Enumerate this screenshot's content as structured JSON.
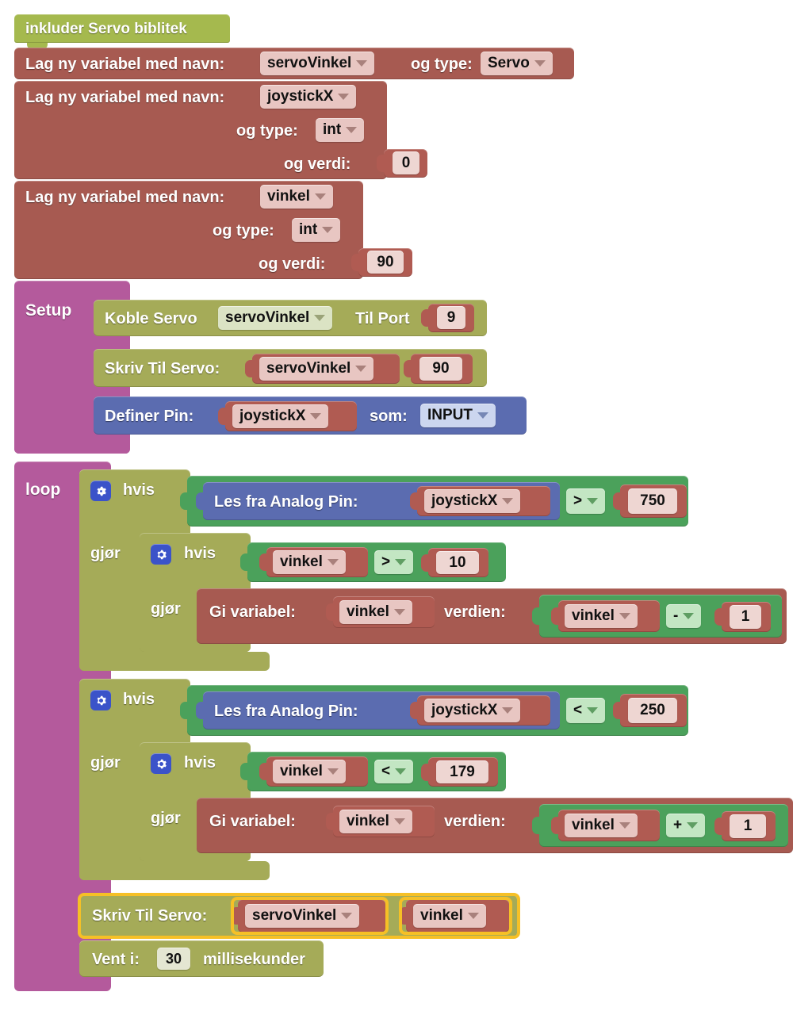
{
  "app": {
    "title": "Blockly Arduino workspace"
  },
  "palette": {
    "include_green": "#a5b94e",
    "variable_brown": "#a75a51",
    "setup_loop_purple": "#b45a9c",
    "olive": "#a5ab58",
    "logic_green": "#4ba15b",
    "io_blue": "#5b6cb0",
    "highlight_yellow": "#f6c026",
    "field_pink": "#e8c6c2",
    "field_green": "#c3e6c3"
  },
  "blocks": {
    "include": {
      "label": "inkluder Servo biblitek"
    },
    "declare_servo": {
      "label_name": "Lag ny variabel med navn:",
      "name_value": "servoVinkel",
      "label_type": "og type:",
      "type_value": "Servo"
    },
    "declare_joystick": {
      "label_name": "Lag ny variabel med navn:",
      "name_value": "joystickX",
      "label_type": "og type:",
      "type_value": "int",
      "label_value": "og verdi:",
      "value": "0"
    },
    "declare_vinkel": {
      "label_name": "Lag ny variabel med navn:",
      "name_value": "vinkel",
      "label_type": "og type:",
      "type_value": "int",
      "label_value": "og verdi:",
      "value": "90"
    },
    "setup": {
      "label": "Setup",
      "attach_servo": {
        "label_prefix": "Koble Servo",
        "servo_value": "servoVinkel",
        "label_mid": "Til Port",
        "port": "9"
      },
      "write_servo": {
        "label": "Skriv Til Servo:",
        "servo_value": "servoVinkel",
        "angle": "90"
      },
      "define_pin": {
        "label": "Definer Pin:",
        "pin_value": "joystickX",
        "label_mode": "som:",
        "mode_value": "INPUT"
      }
    },
    "loop": {
      "label": "loop",
      "if1": {
        "if_label": "hvis",
        "do_label": "gjør",
        "condition": {
          "read_label": "Les fra Analog Pin:",
          "pin_value": "joystickX",
          "operator": ">",
          "right_value": "750"
        },
        "inner_if": {
          "if_label": "hvis",
          "do_label": "gjør",
          "condition": {
            "left_value": "vinkel",
            "operator": ">",
            "right_value": "10"
          },
          "assign": {
            "label_set": "Gi variabel:",
            "target": "vinkel",
            "label_to": "verdien:",
            "expr_left": "vinkel",
            "expr_op": "-",
            "expr_right": "1"
          }
        }
      },
      "if2": {
        "if_label": "hvis",
        "do_label": "gjør",
        "condition": {
          "read_label": "Les fra Analog Pin:",
          "pin_value": "joystickX",
          "operator": "<",
          "right_value": "250"
        },
        "inner_if": {
          "if_label": "hvis",
          "do_label": "gjør",
          "condition": {
            "left_value": "vinkel",
            "operator": "<",
            "right_value": "179"
          },
          "assign": {
            "label_set": "Gi variabel:",
            "target": "vinkel",
            "label_to": "verdien:",
            "expr_left": "vinkel",
            "expr_op": "+",
            "expr_right": "1"
          }
        }
      },
      "write_servo_selected": {
        "label": "Skriv Til Servo:",
        "servo_value": "servoVinkel",
        "angle_value": "vinkel",
        "selected": true
      },
      "wait": {
        "label_prefix": "Vent i:",
        "value": "30",
        "label_suffix": "millisekunder"
      }
    }
  },
  "icons": {
    "mutator": "gear-icon",
    "dropdown": "chevron-down-icon"
  }
}
